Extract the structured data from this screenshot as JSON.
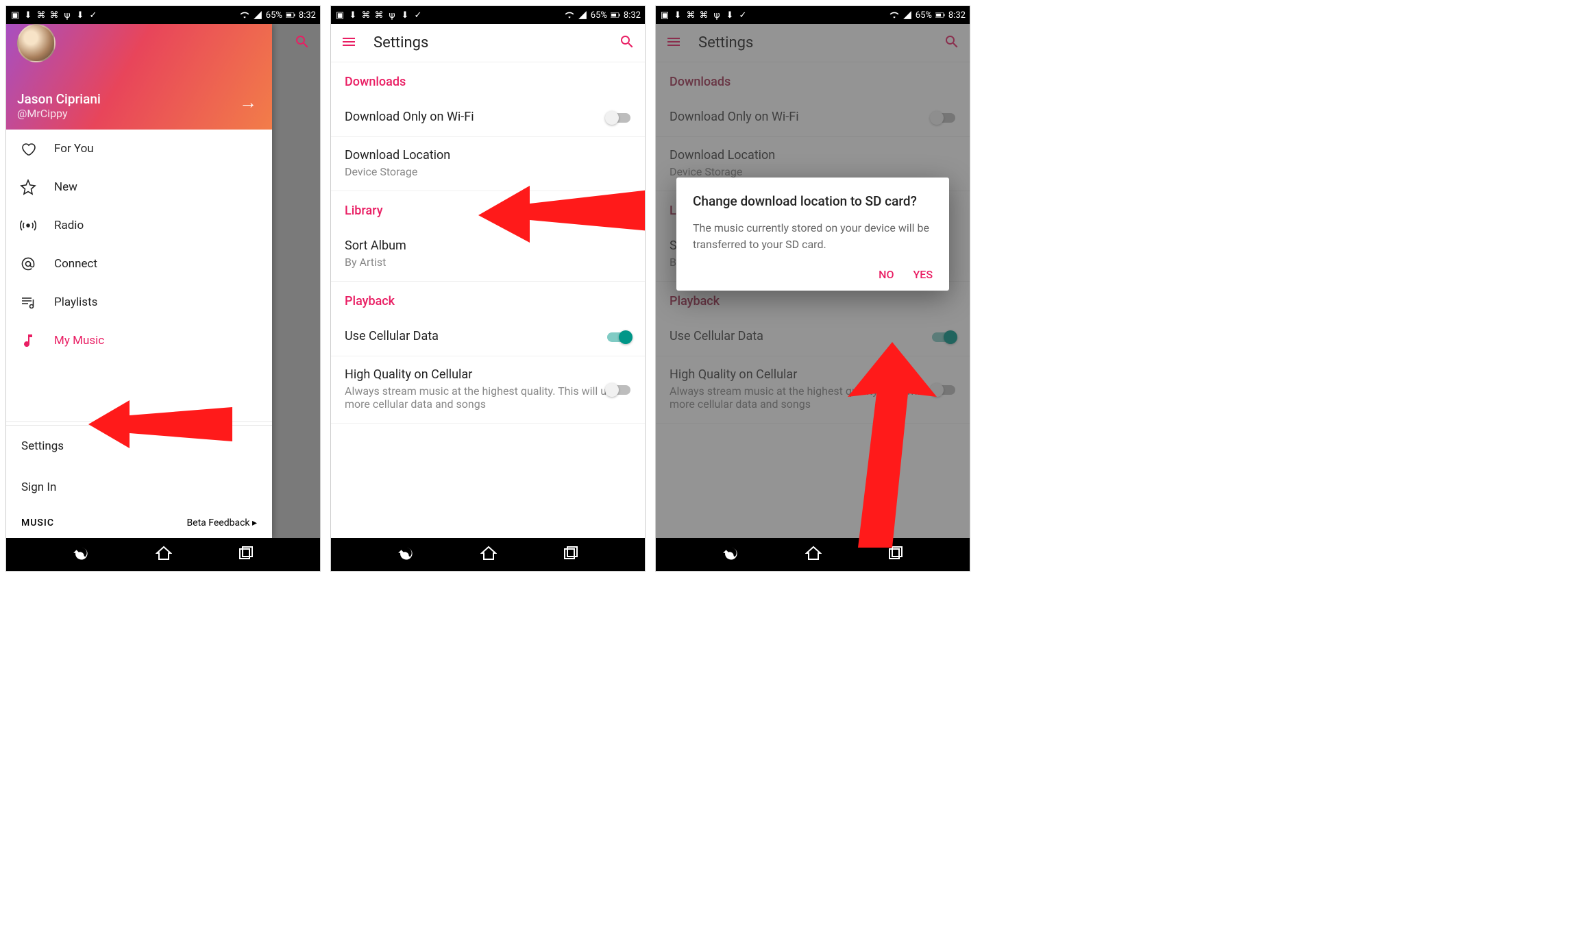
{
  "status_bar": {
    "battery_pct": "65%",
    "time": "8:32"
  },
  "screen1": {
    "profile": {
      "name": "Jason Cipriani",
      "handle": "@MrCippy"
    },
    "items": [
      {
        "label": "For You"
      },
      {
        "label": "New"
      },
      {
        "label": "Radio"
      },
      {
        "label": "Connect"
      },
      {
        "label": "Playlists"
      },
      {
        "label": "My Music"
      }
    ],
    "settings_label": "Settings",
    "signin_label": "Sign In",
    "brand": "MUSIC",
    "beta": "Beta Feedback ▸"
  },
  "settings": {
    "title": "Settings",
    "sections": {
      "downloads": {
        "header": "Downloads",
        "wifi_only": {
          "title": "Download Only on Wi-Fi"
        },
        "location": {
          "title": "Download Location",
          "sub": "Device Storage"
        }
      },
      "library": {
        "header": "Library",
        "sort_album": {
          "title": "Sort Album",
          "sub": "By Artist"
        }
      },
      "playback": {
        "header": "Playback",
        "cellular": {
          "title": "Use Cellular Data"
        },
        "hq": {
          "title": "High Quality on Cellular",
          "sub": "Always stream music at the highest quality. This will use more cellular data and songs"
        }
      }
    }
  },
  "dialog": {
    "title": "Change download location to SD card?",
    "message": "The music currently stored on your device will be transferred to your SD card.",
    "no": "NO",
    "yes": "YES"
  }
}
